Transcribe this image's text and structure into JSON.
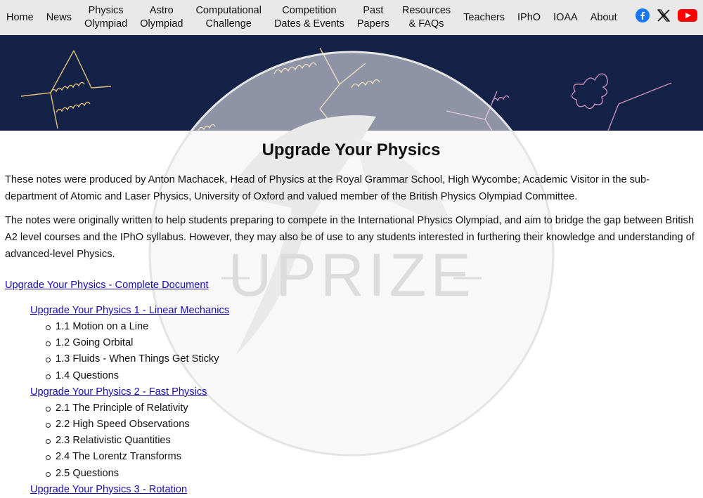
{
  "nav": {
    "items": [
      {
        "l1": "Home",
        "l2": ""
      },
      {
        "l1": "News",
        "l2": ""
      },
      {
        "l1": "Physics",
        "l2": "Olympiad"
      },
      {
        "l1": "Astro",
        "l2": "Olympiad"
      },
      {
        "l1": "Computational",
        "l2": "Challenge"
      },
      {
        "l1": "Competition",
        "l2": "Dates & Events"
      },
      {
        "l1": "Past",
        "l2": "Papers"
      },
      {
        "l1": "Resources",
        "l2": "& FAQs"
      },
      {
        "l1": "Teachers",
        "l2": ""
      },
      {
        "l1": "IPhO",
        "l2": ""
      },
      {
        "l1": "IOAA",
        "l2": ""
      },
      {
        "l1": "About",
        "l2": ""
      }
    ],
    "social": {
      "facebook_icon": "facebook-icon",
      "x_icon": "x-icon",
      "youtube_icon": "youtube-icon"
    }
  },
  "colors": {
    "nav_bg": "#e8e8e8",
    "banner_bg": "#152247",
    "link": "#1a0dab",
    "banner_lines": "#e0c079"
  },
  "watermark": {
    "text": "UPRIZE"
  },
  "page": {
    "title": "Upgrade Your Physics",
    "intro1": "These notes were produced by Anton Machacek, Head of Physics at the Royal Grammar School, High Wycombe; Academic Visitor in the sub-department of Atomic and Laser Physics, University of Oxford and valued member of the British Physics Olympiad Committee.",
    "intro2": "The notes were originally written to help students preparing to compete in the International Physics Olympiad, and aim to bridge the gap between British A2 level courses and the IPhO syllabus. However, they may also be of use to any students interested in furthering their knowledge and understanding of advanced-level Physics.",
    "complete_link": "Upgrade Your Physics - Complete Document",
    "sections": [
      {
        "title": "Upgrade Your Physics 1 - Linear Mechanics",
        "items": [
          "1.1 Motion on a Line",
          "1.2 Going Orbital",
          "1.3 Fluids - When Things Get Sticky",
          "1.4 Questions"
        ]
      },
      {
        "title": "Upgrade Your Physics 2 - Fast Physics",
        "items": [
          "2.1 The Principle of Relativity",
          "2.2 High Speed Observations",
          "2.3 Relativistic Quantities",
          "2.4 The Lorentz Transforms",
          "2.5 Questions"
        ]
      },
      {
        "title": "Upgrade Your Physics 3 - Rotation",
        "items": []
      }
    ]
  }
}
